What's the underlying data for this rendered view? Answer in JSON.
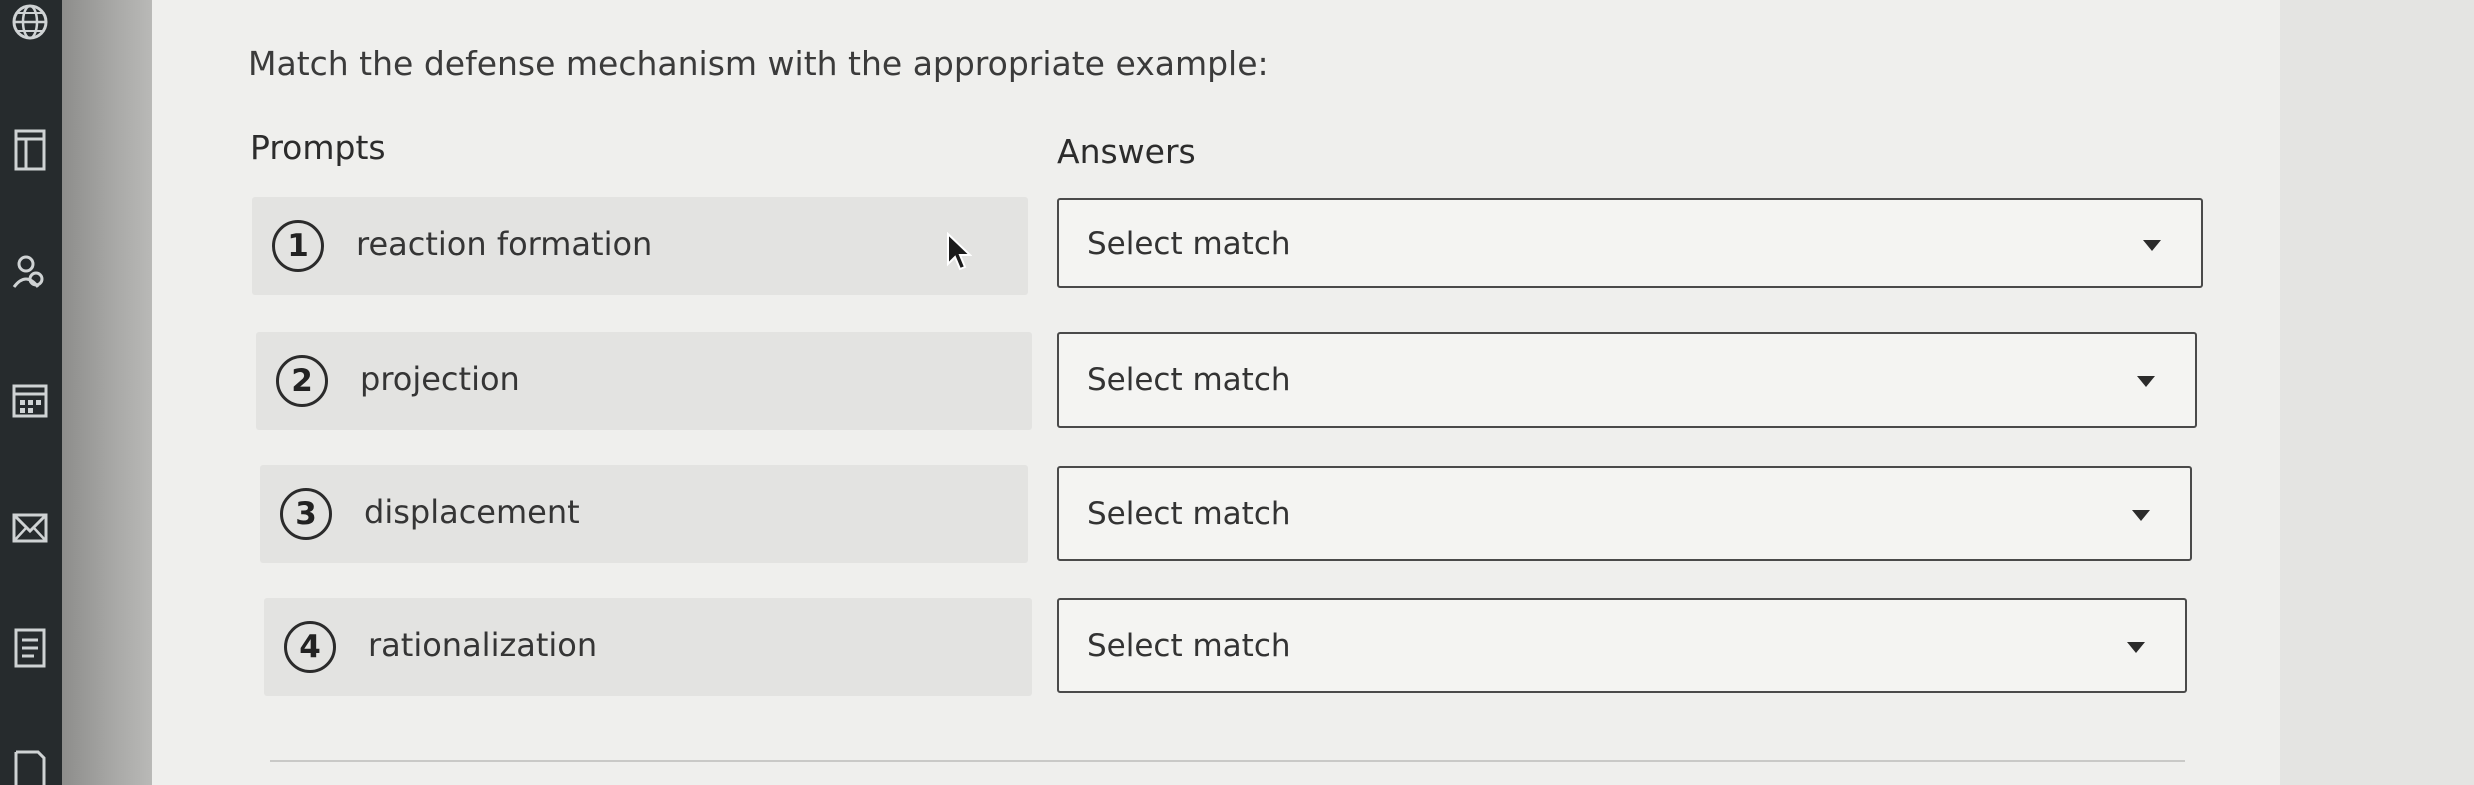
{
  "question": "Match the defense mechanism with the appropriate example:",
  "columns": {
    "prompts": "Prompts",
    "answers": "Answers"
  },
  "prompts": [
    {
      "number": "1",
      "text": "reaction formation"
    },
    {
      "number": "2",
      "text": "projection"
    },
    {
      "number": "3",
      "text": "displacement"
    },
    {
      "number": "4",
      "text": "rationalization"
    }
  ],
  "answers": [
    {
      "value": "Select match"
    },
    {
      "value": "Select match"
    },
    {
      "value": "Select match"
    },
    {
      "value": "Select match"
    }
  ],
  "sidebar_icons": [
    "globe-icon",
    "table-icon",
    "people-icon",
    "calendar-icon",
    "mail-icon",
    "notes-icon",
    "document-icon"
  ]
}
